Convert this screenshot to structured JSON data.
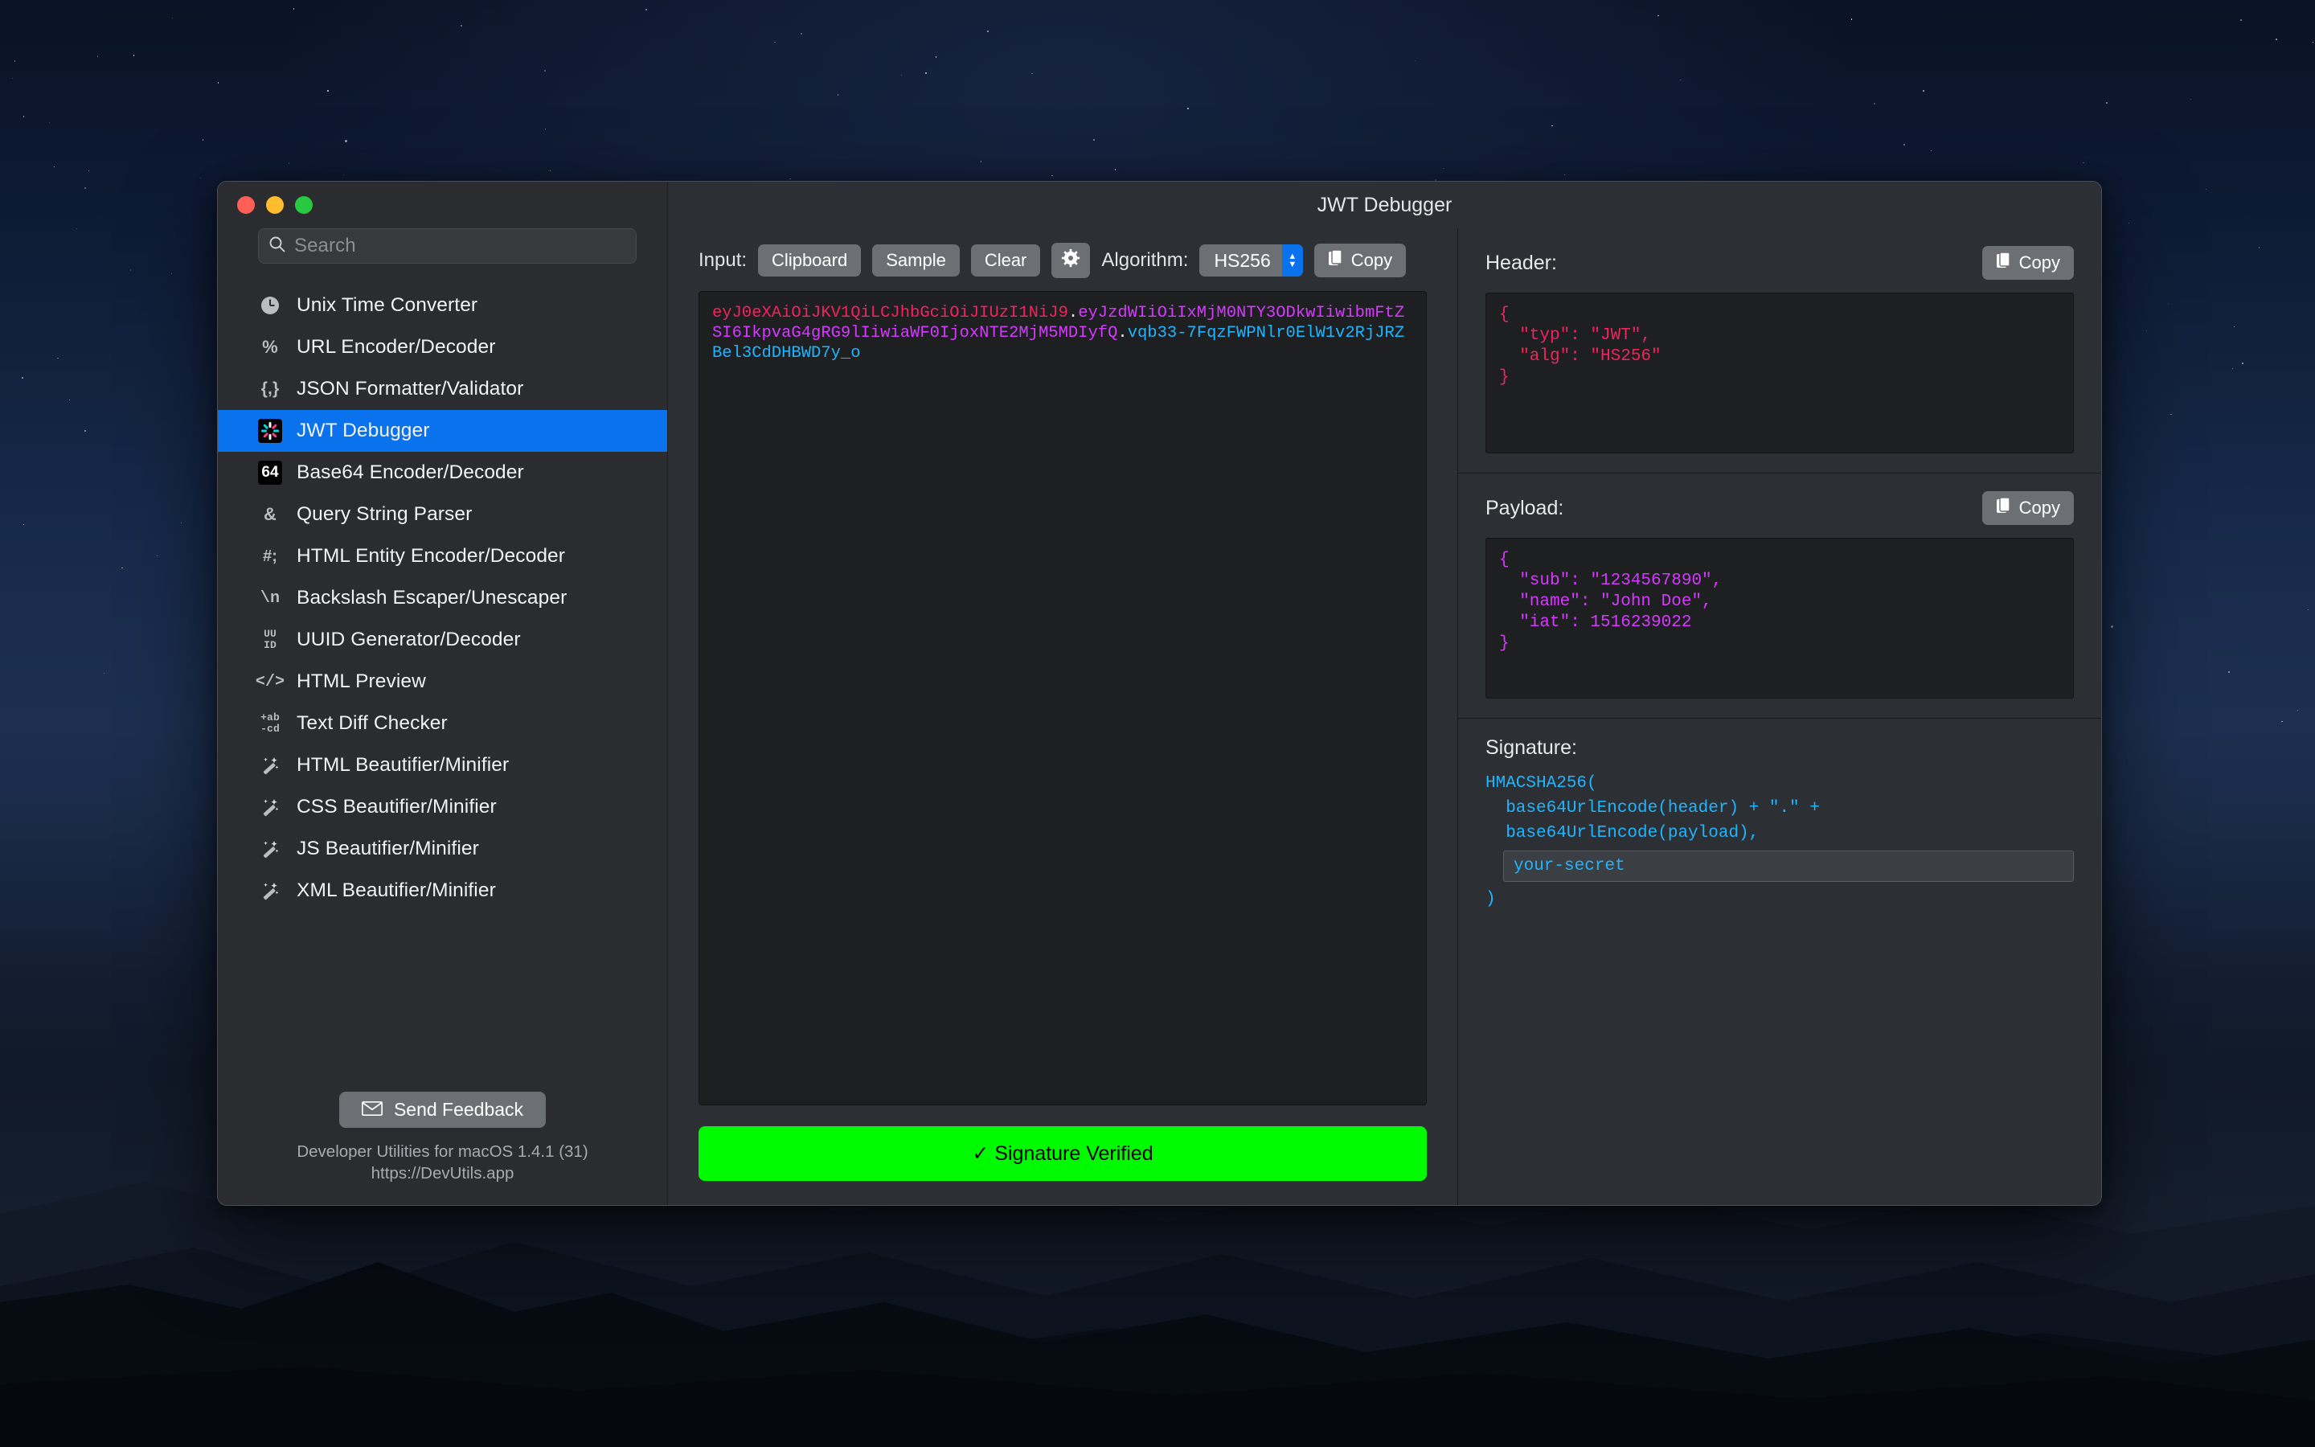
{
  "window": {
    "title": "JWT Debugger"
  },
  "sidebar": {
    "search": {
      "placeholder": "Search"
    },
    "items": [
      {
        "label": "Unix Time Converter",
        "icon": "clock-icon"
      },
      {
        "label": "URL Encoder/Decoder",
        "icon": "percent-icon"
      },
      {
        "label": "JSON Formatter/Validator",
        "icon": "braces-icon"
      },
      {
        "label": "JWT Debugger",
        "icon": "jwt-burst-icon"
      },
      {
        "label": "Base64 Encoder/Decoder",
        "icon": "base64-icon"
      },
      {
        "label": "Query String Parser",
        "icon": "ampersand-icon"
      },
      {
        "label": "HTML Entity Encoder/Decoder",
        "icon": "hash-semicolon-icon"
      },
      {
        "label": "Backslash Escaper/Unescaper",
        "icon": "backslash-n-icon"
      },
      {
        "label": "UUID Generator/Decoder",
        "icon": "uuid-icon"
      },
      {
        "label": "HTML Preview",
        "icon": "angle-brackets-icon"
      },
      {
        "label": "Text Diff Checker",
        "icon": "diff-icon"
      },
      {
        "label": "HTML Beautifier/Minifier",
        "icon": "magic-wand-icon"
      },
      {
        "label": "CSS Beautifier/Minifier",
        "icon": "magic-wand-icon"
      },
      {
        "label": "JS Beautifier/Minifier",
        "icon": "magic-wand-icon"
      },
      {
        "label": "XML Beautifier/Minifier",
        "icon": "magic-wand-icon"
      }
    ],
    "selected_index": 3,
    "footer": {
      "feedback_label": "Send Feedback",
      "version_line": "Developer Utilities for macOS 1.4.1 (31)",
      "url_line": "https://DevUtils.app"
    }
  },
  "toolbar": {
    "input_label": "Input:",
    "clipboard_label": "Clipboard",
    "sample_label": "Sample",
    "clear_label": "Clear",
    "settings_icon": "gear-icon",
    "algorithm_label": "Algorithm:",
    "algorithm_value": "HS256",
    "copy_label": "Copy"
  },
  "token": {
    "header_part": "eyJ0eXAiOiJKV1QiLCJhbGciOiJIUzI1NiJ9",
    "dot1": ".",
    "payload_part": "eyJzdWIiOiIxMjM0NTY3ODkwIiwibmFtZSI6IkpvaG4gRG9lIiwiaWF0IjoxNTE2MjM5MDIyfQ",
    "dot2": ".",
    "signature_part": "vqb33-7FqzFWPNlr0ElW1v2RjJRZBel3CdDHBWD7y_o"
  },
  "status": {
    "text": "✓ Signature Verified",
    "color": "#00fa00"
  },
  "header_panel": {
    "title": "Header:",
    "copy_label": "Copy",
    "json": "{\n  \"typ\": \"JWT\",\n  \"alg\": \"HS256\"\n}",
    "color": "#f2245f"
  },
  "payload_panel": {
    "title": "Payload:",
    "copy_label": "Copy",
    "json": "{\n  \"sub\": \"1234567890\",\n  \"name\": \"John Doe\",\n  \"iat\": 1516239022\n}",
    "color": "#d63aff"
  },
  "signature_panel": {
    "title": "Signature:",
    "line1": "HMACSHA256(",
    "line2": "  base64UrlEncode(header) + \".\" +",
    "line3": "  base64UrlEncode(payload),",
    "secret_value": "your-secret",
    "line4": ")",
    "color": "#1fb6ff"
  }
}
